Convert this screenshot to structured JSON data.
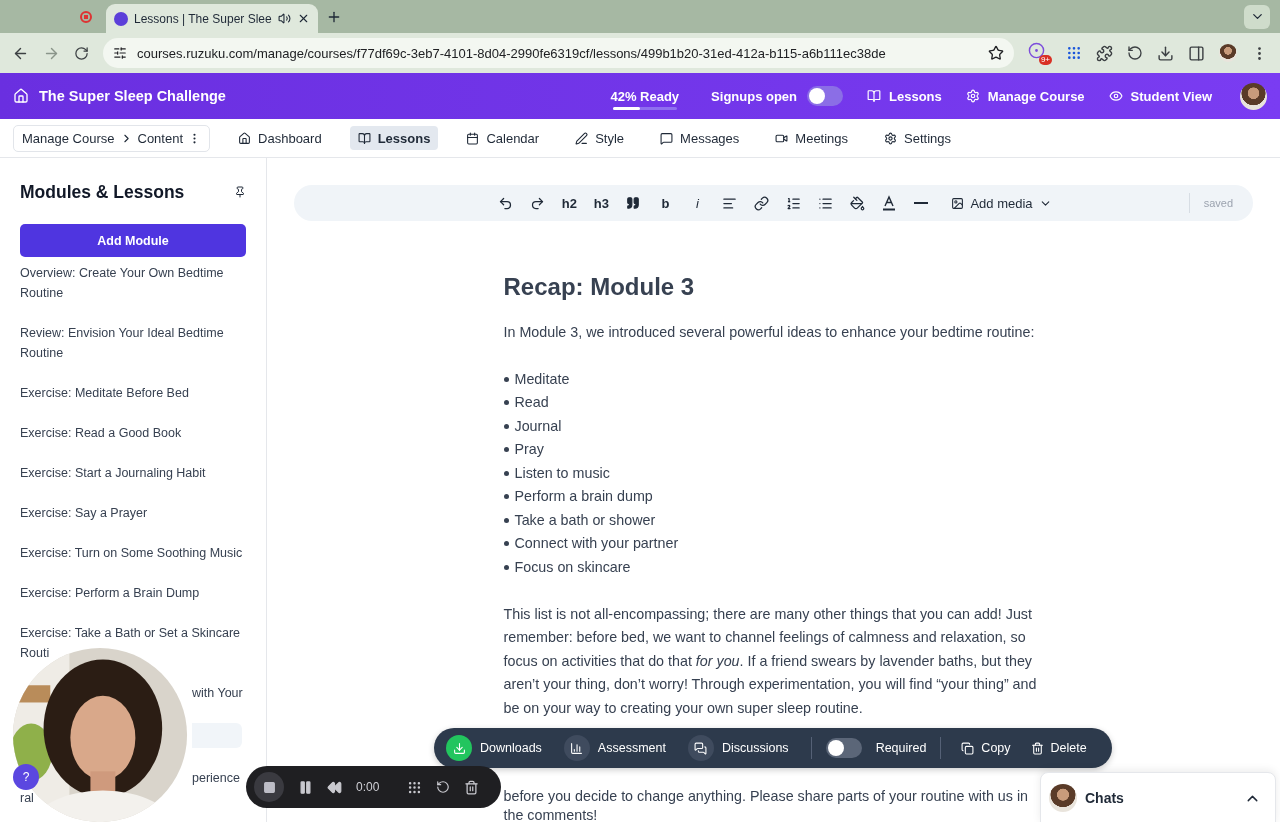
{
  "browser": {
    "tab_title": "Lessons | The Super Slee",
    "url": "courses.ruzuku.com/manage/courses/f77df69c-3eb7-4101-8d04-2990fe6319cf/lessons/499b1b20-31ed-412a-b115-a6b111ec38de",
    "extension_badge": "9+"
  },
  "header": {
    "title": "The Super Sleep Challenge",
    "ready": {
      "label": "42% Ready",
      "level": 0.42
    },
    "signups": {
      "label": "Signups open",
      "on": false
    },
    "links": [
      "Lessons",
      "Manage Course",
      "Student View"
    ]
  },
  "nav": {
    "breadcrumb": [
      "Manage Course",
      "Content"
    ],
    "tabs": [
      {
        "label": "Dashboard",
        "selected": false
      },
      {
        "label": "Lessons",
        "selected": true
      },
      {
        "label": "Calendar",
        "selected": false
      },
      {
        "label": "Style",
        "selected": false
      },
      {
        "label": "Messages",
        "selected": false
      },
      {
        "label": "Meetings",
        "selected": false
      },
      {
        "label": "Settings",
        "selected": false
      }
    ]
  },
  "sidebar": {
    "title": "Modules & Lessons",
    "add_button": "Add Module",
    "items": [
      {
        "kind": "lesson",
        "text": "Overview: Create Your Own Bedtime Routine",
        "selected": false
      },
      {
        "kind": "lesson",
        "text": "Review: Envision Your Ideal Bedtime Routine",
        "selected": false
      },
      {
        "kind": "lesson",
        "text": "Exercise: Meditate Before Bed",
        "selected": false
      },
      {
        "kind": "lesson",
        "text": "Exercise: Read a Good Book",
        "selected": false
      },
      {
        "kind": "lesson",
        "text": "Exercise: Start a Journaling Habit",
        "selected": false
      },
      {
        "kind": "lesson",
        "text": "Exercise: Say a Prayer",
        "selected": false
      },
      {
        "kind": "lesson",
        "text": "Exercise: Turn on Some Soothing Music",
        "selected": false
      },
      {
        "kind": "lesson",
        "text": "Exercise: Perform a Brain Dump",
        "selected": false
      },
      {
        "kind": "lesson",
        "text": "Exercise: Take a Bath or Set a Skincare\nRouti",
        "selected": false
      },
      {
        "kind": "fragment",
        "text": "with Your",
        "selected": false
      },
      {
        "kind": "hidden",
        "selected": true
      },
      {
        "kind": "fragment",
        "text": "perience\nral",
        "selected": false
      }
    ]
  },
  "editor_toolbar": {
    "headings": [
      "h2",
      "h3"
    ],
    "bold": "b",
    "italic": "i",
    "add_media": "Add media",
    "status": "saved"
  },
  "content": {
    "title": "Recap: Module 3",
    "intro": "In Module 3, we introduced several powerful ideas to enhance your bedtime routine:",
    "bullets": [
      "Meditate",
      "Read",
      "Journal",
      "Pray",
      "Listen to music",
      "Perform a brain dump",
      "Take a bath or shower",
      "Connect with your partner",
      "Focus on skincare"
    ],
    "paragraphs": [
      "This list is not all-encompassing; there are many other things that you can add! Just remember: before bed, we want to channel feelings of calmness and relaxation, so focus on activities that do that *for you*. If a friend swears by lavender baths, but they aren’t your thing, don’t worry! Through experimentation, you will find “your thing” and be on your way to creating your own super sleep routine.",
      "before you decide to change anything. Please share parts of your routine with us in the comments!"
    ]
  },
  "lesson_toolbar": {
    "features": [
      {
        "label": "Downloads",
        "on": true
      },
      {
        "label": "Assessment",
        "on": false
      },
      {
        "label": "Discussions",
        "on": false
      }
    ],
    "required": {
      "label": "Required",
      "on": false
    },
    "copy": "Copy",
    "delete": "Delete"
  },
  "recorder": {
    "time": "0:00"
  },
  "help": "?",
  "chats": {
    "label": "Chats"
  }
}
